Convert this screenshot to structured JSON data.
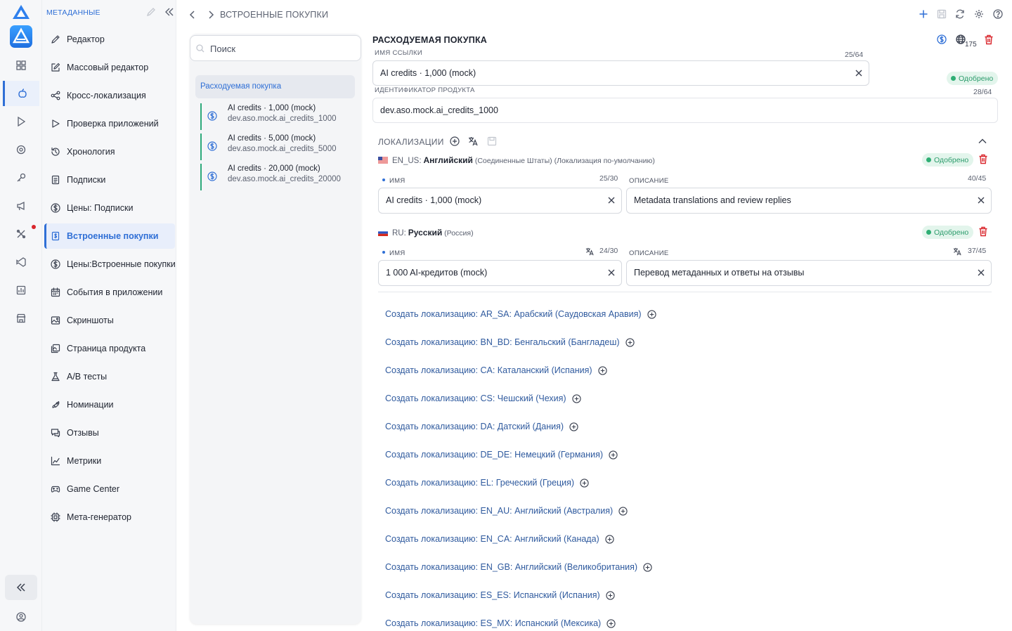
{
  "sidebar": {
    "header": "МЕТАДАННЫЕ",
    "items": [
      {
        "label": "Редактор",
        "icon": "pencil-icon"
      },
      {
        "label": "Массовый редактор",
        "icon": "edit-square-icon"
      },
      {
        "label": "Кросс-локализация",
        "icon": "share-icon"
      },
      {
        "label": "Проверка приложений",
        "icon": "play-outline-icon"
      },
      {
        "label": "Хронология",
        "icon": "history-icon"
      },
      {
        "label": "Подписки",
        "icon": "document-icon"
      },
      {
        "label": "Цены: Подписки",
        "icon": "dollar-circle-icon"
      },
      {
        "label": "Встроенные покупки",
        "icon": "receipt-icon",
        "active": true
      },
      {
        "label": "Цены:Встроенные покупки",
        "icon": "dollar-circle-icon"
      },
      {
        "label": "События в приложении",
        "icon": "calendar-icon"
      },
      {
        "label": "Скриншоты",
        "icon": "image-icon"
      },
      {
        "label": "Страница продукта",
        "icon": "pages-icon"
      },
      {
        "label": "A/B тесты",
        "icon": "flask-icon"
      },
      {
        "label": "Номинации",
        "icon": "rocket-icon"
      },
      {
        "label": "Отзывы",
        "icon": "chat-icon"
      },
      {
        "label": "Метрики",
        "icon": "chart-icon"
      },
      {
        "label": "Game Center",
        "icon": "gamepad-icon"
      },
      {
        "label": "Мета-генератор",
        "icon": "chip-icon"
      }
    ]
  },
  "topbar": {
    "breadcrumb": "ВСТРОЕННЫЕ ПОКУПКИ"
  },
  "list": {
    "search_placeholder": "Поиск",
    "group_title": "Расходуемая покупка",
    "items": [
      {
        "title": "AI credits · 1,000 (mock)",
        "subtitle": "dev.aso.mock.ai_credits_1000"
      },
      {
        "title": "AI credits · 5,000 (mock)",
        "subtitle": "dev.aso.mock.ai_credits_5000"
      },
      {
        "title": "AI credits · 20,000 (mock)",
        "subtitle": "dev.aso.mock.ai_credits_20000"
      }
    ]
  },
  "detail": {
    "title": "РАСХОДУЕМАЯ ПОКУПКА",
    "globe_count": "175",
    "status": "Одобрено",
    "reference_name": {
      "label": "ИМЯ ССЫЛКИ",
      "counter": "25/64",
      "value": "AI credits · 1,000 (mock)"
    },
    "product_id": {
      "label": "ИДЕНТИФИКАТОР ПРОДУКТА",
      "counter": "28/64",
      "value": "dev.aso.mock.ai_credits_1000"
    },
    "localizations_title": "ЛОКАЛИЗАЦИИ",
    "locales": [
      {
        "code": "EN_US:",
        "language": "Английский",
        "region": "(Соединенные Штаты) (Локализация по-умолчанию)",
        "status": "Одобрено",
        "name_label": "ИМЯ",
        "name_counter": "25/30",
        "name_value": "AI credits · 1,000 (mock)",
        "desc_label": "ОПИСАНИЕ",
        "desc_counter": "40/45",
        "desc_value": "Metadata translations and review replies"
      },
      {
        "code": "RU:",
        "language": "Русский",
        "region": "(Россия)",
        "status": "Одобрено",
        "name_label": "ИМЯ",
        "name_counter": "24/30",
        "name_value": "1 000 AI-кредитов (mock)",
        "desc_label": "ОПИСАНИЕ",
        "desc_counter": "37/45",
        "desc_value": "Перевод метаданных и ответы на отзывы"
      }
    ],
    "create_links": [
      "Создать локализацию: AR_SA: Арабский (Саудовская Аравия)",
      "Создать локализацию: BN_BD: Бенгальский (Бангладеш)",
      "Создать локализацию: CA: Каталанский (Испания)",
      "Создать локализацию: CS: Чешский (Чехия)",
      "Создать локализацию: DA: Датский (Дания)",
      "Создать локализацию: DE_DE: Немецкий (Германия)",
      "Создать локализацию: EL: Греческий (Греция)",
      "Создать локализацию: EN_AU: Английский (Австралия)",
      "Создать локализацию: EN_CA: Английский (Канада)",
      "Создать локализацию: EN_GB: Английский (Великобритания)",
      "Создать локализацию: ES_ES: Испанский (Испания)",
      "Создать локализацию: ES_MX: Испанский (Мексика)"
    ]
  },
  "colors": {
    "accent": "#2f6fd6",
    "approved_bg": "#e3f5ec",
    "approved_text": "#2b9b6b",
    "danger": "#d9262c",
    "link": "#2f5a9e"
  }
}
